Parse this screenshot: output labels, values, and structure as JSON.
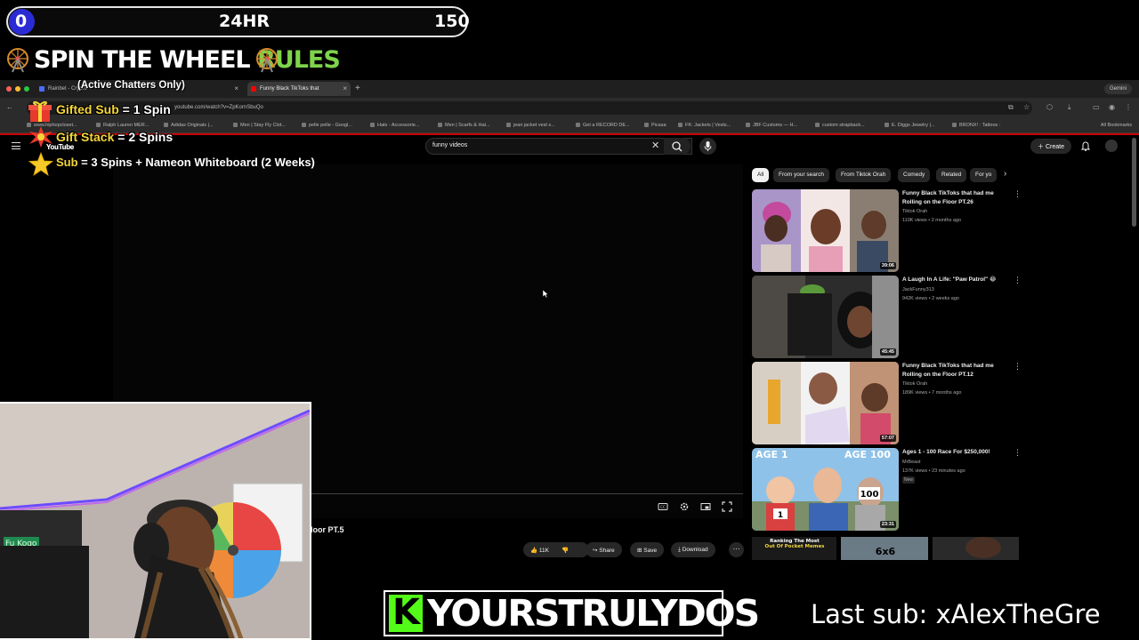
{
  "counter": {
    "left": "0",
    "middle": "24HR",
    "right": "150"
  },
  "spin": {
    "title_white": "SPIN THE WHEEL",
    "title_green": "RULES",
    "chatters": "(Active Chatters Only)",
    "rules": [
      {
        "key": "Gifted Sub",
        "value": " = 1 Spin"
      },
      {
        "key": "Gift Stack",
        "value": " = 2 Spins"
      },
      {
        "key": "Sub",
        "value": " = 3 Spins + Nameon Whiteboard (2 Weeks)"
      }
    ]
  },
  "browser": {
    "tabs": [
      {
        "label": "Rainbet - Crypto",
        "color": "#4a6cff"
      },
      {
        "label": "Funny Black TikToks that",
        "color": "#ff0000"
      }
    ],
    "url": "youtube.com/watch?v=ZpKornSbuQo",
    "gemini": "Gemini",
    "all_bookmarks": "All Bookmarks",
    "bookmarks": [
      "www.hiphopcloset...",
      "Ralph Lauren MER...",
      "Adidas Originals |...",
      "Men | Stay Fly Clot...",
      "pelle pelle - Googl...",
      "Hats - Accessorie...",
      "Men | Scarfs & Hat...",
      "jean jacket vest s...",
      "Get a RECORD DE...",
      "Picasa",
      "FK: Jackets | Vests...",
      "JBF Customs — H...",
      "custom strapback...",
      "E. Diggs Jewelry |...",
      "BRONX! : Tattoos :"
    ]
  },
  "youtube": {
    "logo": "YouTube",
    "search_value": "funny videos",
    "create": "Create",
    "video_title_visible": "loor PT.5",
    "likes": "11K",
    "share": "Share",
    "save": "Save",
    "download": "Download",
    "chips": [
      "All",
      "From your search",
      "From Tiktok Orah",
      "Comedy",
      "Related",
      "For yo"
    ],
    "recommendations": [
      {
        "title": "Funny Black TikToks that had me Rolling on the Floor PT.26",
        "channel": "Tiktok Orah",
        "meta": "110K views • 2 months ago",
        "duration": "39:06",
        "badge_new": ""
      },
      {
        "title": "A Laugh In A Life: \"Paw Patrol\" 😂",
        "channel": "JackFunny313",
        "meta": "942K views • 2 weeks ago",
        "duration": "45:45",
        "badge_new": ""
      },
      {
        "title": "Funny Black TikToks that had me Rolling on the Floor PT.12",
        "channel": "Tiktok Orah",
        "meta": "189K views • 7 months ago",
        "duration": "57:07",
        "badge_new": ""
      },
      {
        "title": "Ages 1 - 100 Race For $250,000!",
        "channel": "MrBeast",
        "meta": "137K views • 23 minutes ago",
        "duration": "23:31",
        "badge_new": "New"
      }
    ],
    "thumb4_age1": "AGE 1",
    "thumb4_age100": "AGE 100",
    "thumb4_bib1": "1",
    "thumb4_bib100": "100",
    "shorts_text1": "Ranking The Most",
    "shorts_text2": "Out Of Pocket Memes",
    "shorts_text3": "6x6"
  },
  "webcam": {
    "sign": "Fu Kogo"
  },
  "footer": {
    "kick_letter": "K",
    "kick_name": "YOURSTRULYDOS",
    "last_sub": "Last sub: xAlexTheGre"
  },
  "colors": {
    "brand_green": "#53fc18",
    "spin_green": "#7ed34b",
    "gold": "#f4d63a",
    "yt_red": "#ff0000",
    "counter_blue": "#2b2bd6"
  }
}
